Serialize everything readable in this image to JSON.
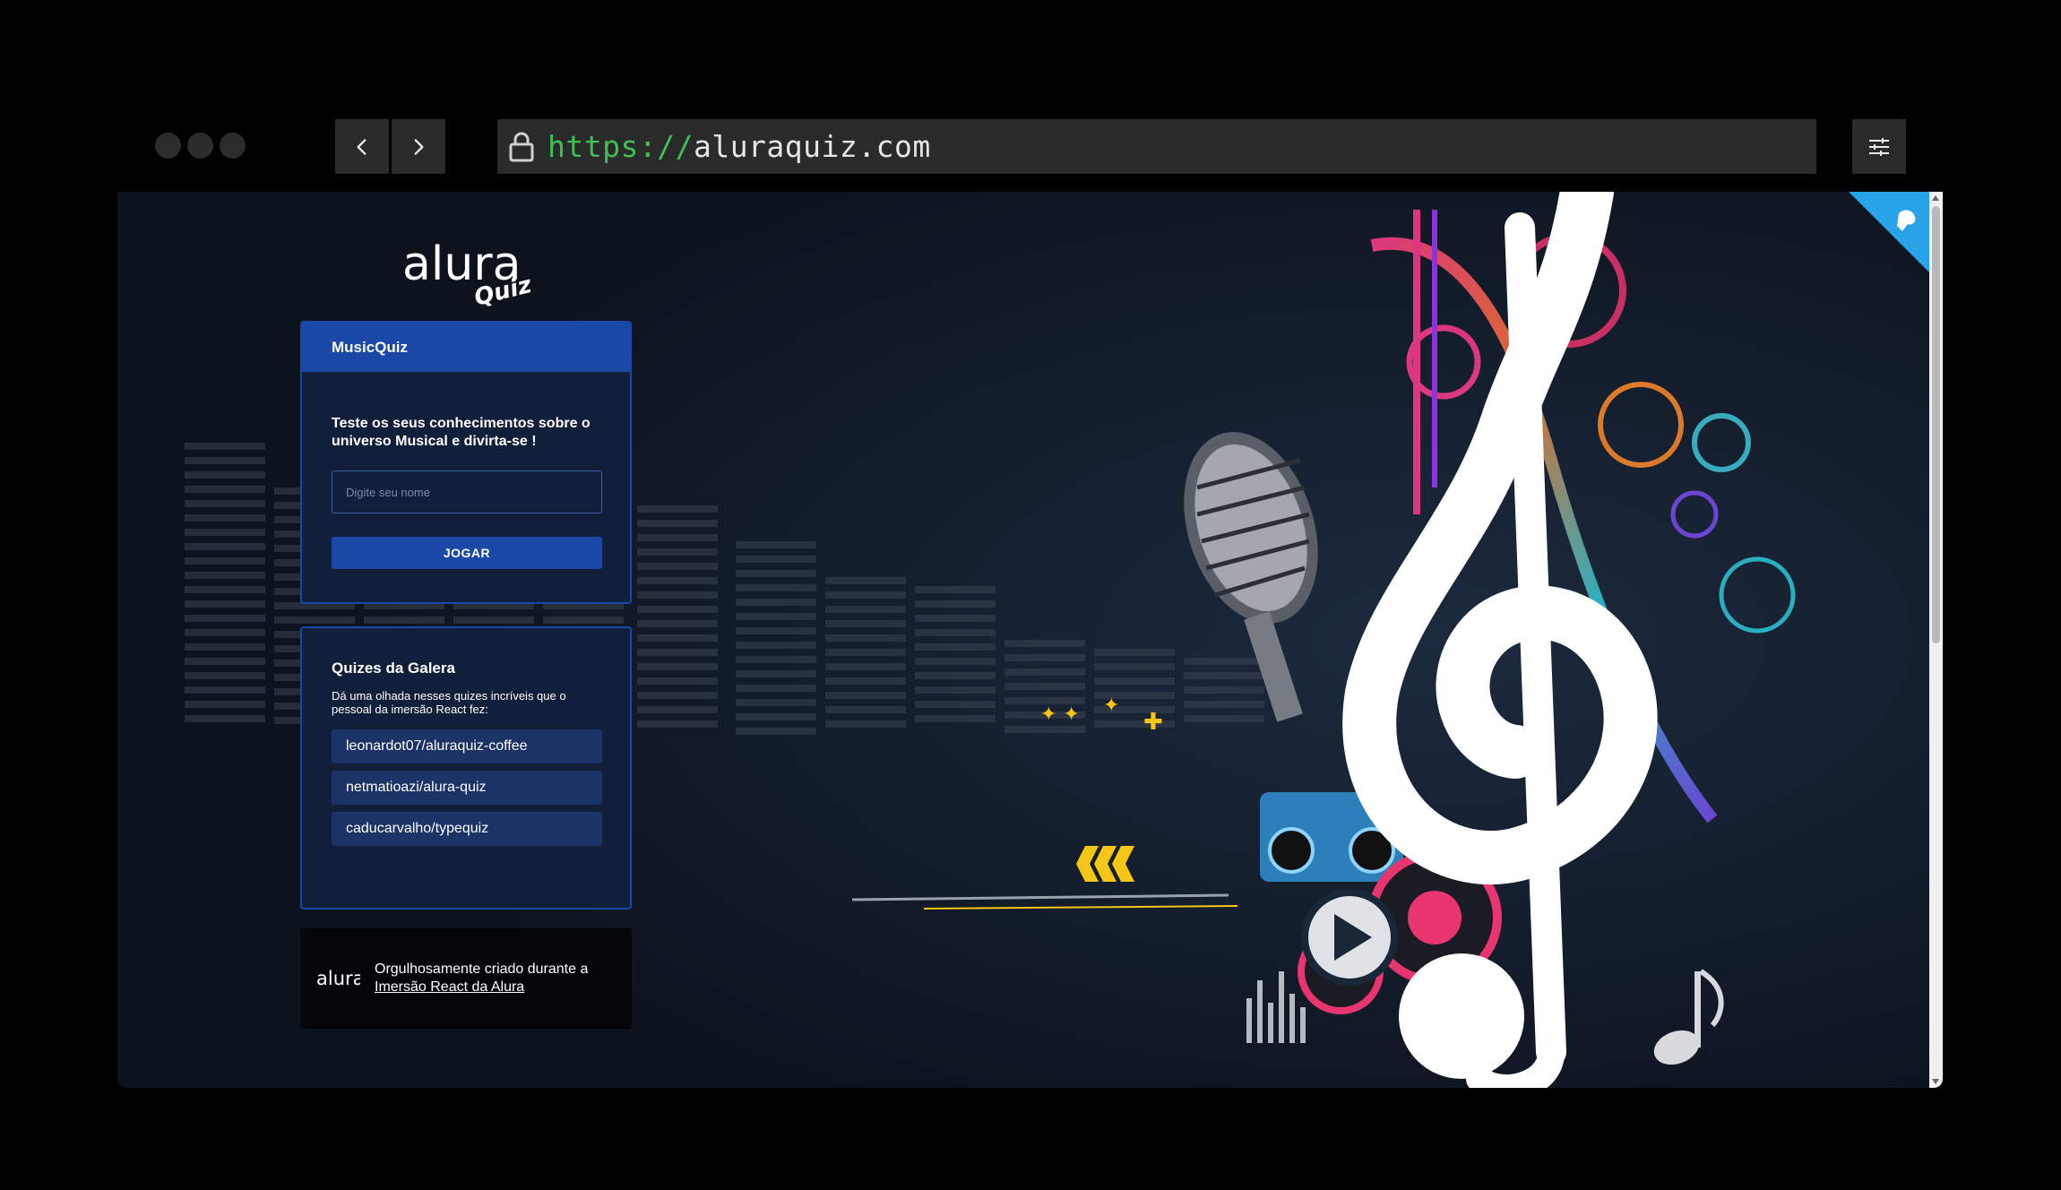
{
  "browser": {
    "url_protocol": "https://",
    "url_host": "aluraquiz.com"
  },
  "logo": {
    "brand": "alura",
    "sub": "Quiz!"
  },
  "quiz_widget": {
    "title": "MusicQuiz",
    "description": "Teste os seus conhecimentos sobre o universo Musical e divirta-se !",
    "input_placeholder": "Digite seu nome",
    "play_button": "JOGAR"
  },
  "community_widget": {
    "title": "Quizes da Galera",
    "description": "Dá uma olhada nesses quizes incríveis que o pessoal da imersão React fez:",
    "links": [
      {
        "label": "leonardot07/aluraquiz-coffee"
      },
      {
        "label": "netmatioazi/alura-quiz"
      },
      {
        "label": "caducarvalho/typequiz"
      }
    ]
  },
  "footer": {
    "brand": "alura",
    "text_prefix": "Orgulhosamente criado durante a ",
    "link_text": "Imersão React da Alura"
  },
  "colors": {
    "primary": "#1a48a6",
    "widget_bg": "#121f3b",
    "url_protocol": "#3fbf55",
    "github_corner": "#29a3e8"
  }
}
